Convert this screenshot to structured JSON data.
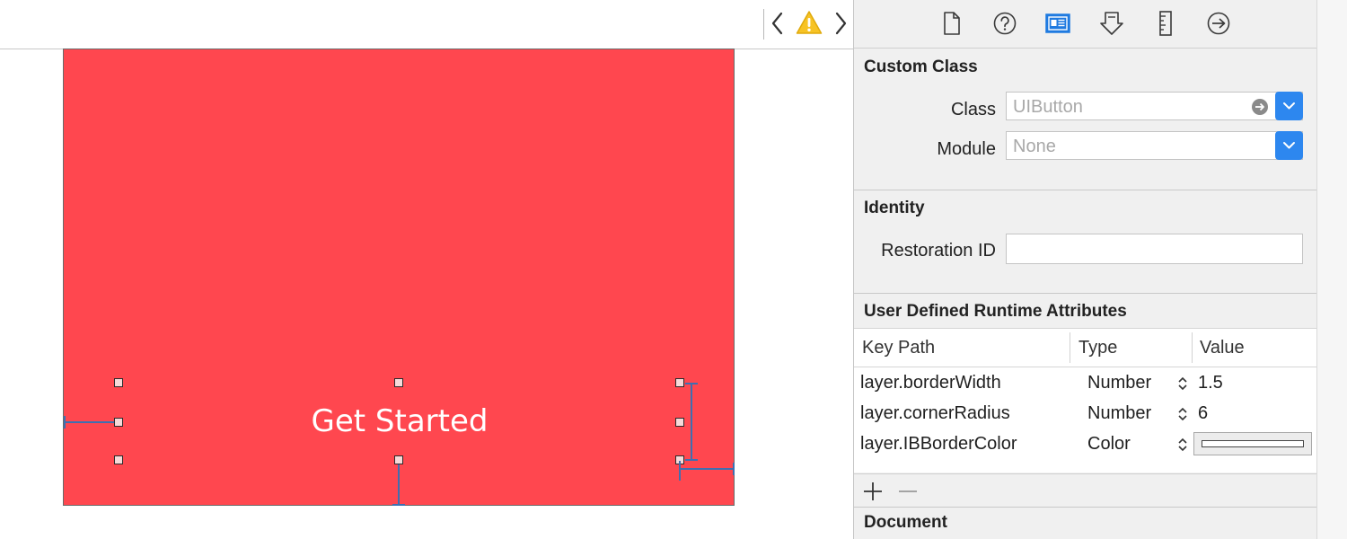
{
  "canvas": {
    "button_title": "Get Started",
    "view_color": "#ff474f"
  },
  "toolbar": {
    "icons": [
      "chevron-left-icon",
      "warning-icon",
      "chevron-right-icon"
    ]
  },
  "inspector": {
    "tabs": [
      "file-icon",
      "help-icon",
      "identity-icon",
      "attributes-icon",
      "size-icon",
      "connections-icon"
    ],
    "active_tab": "identity-icon",
    "custom_class": {
      "title": "Custom Class",
      "class_label": "Class",
      "class_placeholder": "UIButton",
      "module_label": "Module",
      "module_placeholder": "None"
    },
    "identity": {
      "title": "Identity",
      "restoration_label": "Restoration ID",
      "restoration_value": ""
    },
    "runtime_attributes": {
      "title": "User Defined Runtime Attributes",
      "columns": [
        "Key Path",
        "Type",
        "Value"
      ],
      "rows": [
        {
          "key": "layer.borderWidth",
          "type": "Number",
          "value": "1.5"
        },
        {
          "key": "layer.cornerRadius",
          "type": "Number",
          "value": "6"
        },
        {
          "key": "layer.IBBorderColor",
          "type": "Color",
          "value": ""
        }
      ]
    },
    "document": {
      "title": "Document"
    },
    "accent_color": "#2d87ef"
  }
}
